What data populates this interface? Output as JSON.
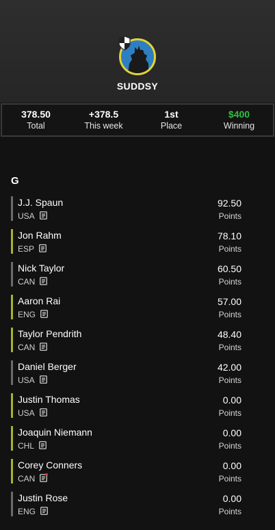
{
  "team": {
    "name": "SUDDSY"
  },
  "stats": [
    {
      "value": "378.50",
      "label": "Total"
    },
    {
      "value": "+378.5",
      "label": "This week"
    },
    {
      "value": "1st",
      "label": "Place"
    },
    {
      "value": "$400",
      "label": "Winning",
      "color": "#2fbf3f"
    }
  ],
  "section": {
    "title": "G"
  },
  "players": [
    {
      "name": "J.J. Spaun",
      "country": "USA",
      "points": "92.50",
      "points_label": "Points",
      "active": false
    },
    {
      "name": "Jon Rahm",
      "country": "ESP",
      "points": "78.10",
      "points_label": "Points",
      "active": true
    },
    {
      "name": "Nick Taylor",
      "country": "CAN",
      "points": "60.50",
      "points_label": "Points",
      "active": false
    },
    {
      "name": "Aaron Rai",
      "country": "ENG",
      "points": "57.00",
      "points_label": "Points",
      "active": true
    },
    {
      "name": "Taylor Pendrith",
      "country": "CAN",
      "points": "48.40",
      "points_label": "Points",
      "active": true
    },
    {
      "name": "Daniel Berger",
      "country": "USA",
      "points": "42.00",
      "points_label": "Points",
      "active": false
    },
    {
      "name": "Justin Thomas",
      "country": "USA",
      "points": "0.00",
      "points_label": "Points",
      "active": true
    },
    {
      "name": "Joaquin Niemann",
      "country": "CHL",
      "points": "0.00",
      "points_label": "Points",
      "active": true
    },
    {
      "name": "Corey Conners",
      "country": "CAN",
      "points": "0.00",
      "points_label": "Points",
      "active": true,
      "note_alert": true
    },
    {
      "name": "Justin Rose",
      "country": "ENG",
      "points": "0.00",
      "points_label": "Points",
      "active": false
    }
  ],
  "colors": {
    "active_bar": "#a8b42a",
    "inactive_bar": "#6c6c6c",
    "winning": "#2fbf3f",
    "avatar_ring": "#e6d235",
    "avatar_bg": "#2e7fc1"
  },
  "icons": {
    "player_note": "note-icon",
    "avatar": "team-avatar",
    "badge": "shield-icon"
  }
}
